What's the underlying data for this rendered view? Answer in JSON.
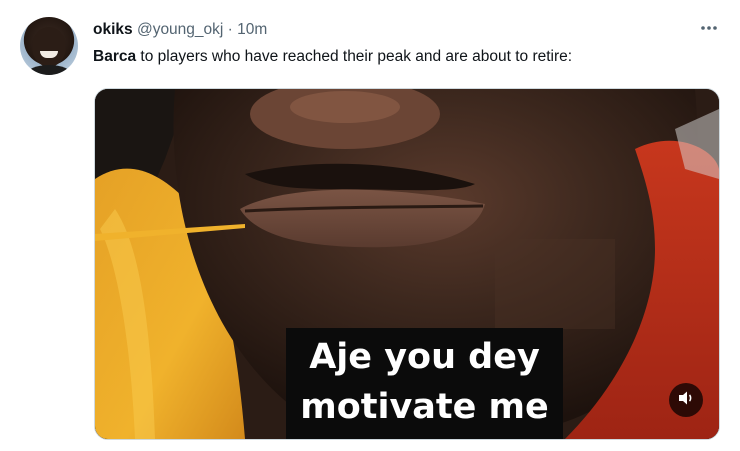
{
  "tweet": {
    "display_name": "okiks",
    "handle": "@young_okj",
    "separator": "·",
    "time": "10m",
    "text_mention": "Barca",
    "text_rest": " to players who have reached their peak and are about to retire:",
    "more_icon": "more-horizontal-icon"
  },
  "media": {
    "caption_line_1": "Aje you dey",
    "caption_line_2": "motivate me",
    "volume_icon": "volume-icon"
  }
}
